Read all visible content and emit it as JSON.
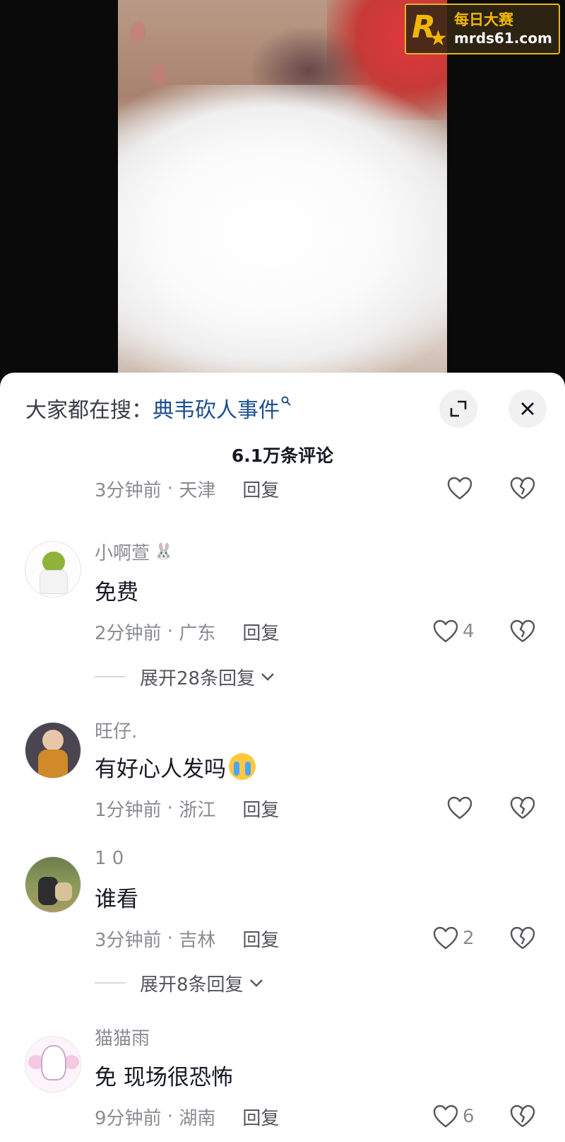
{
  "watermark": {
    "logo_letter": "R",
    "name": "每日大赛",
    "url": "mrds61.com"
  },
  "sheet": {
    "search": {
      "prefix": "大家都在搜：",
      "term": "典韦砍人事件"
    },
    "comment_count": "6.1万条评论",
    "reply_label": "回复",
    "top_meta": {
      "time": "3分钟前",
      "location": "天津"
    },
    "comments": [
      {
        "username": "小啊萱",
        "text": "免费",
        "time": "2分钟前",
        "location": "广东",
        "likes": "4",
        "expand_label": "展开28条回复"
      },
      {
        "username": "旺仔.",
        "text": "有好心人发吗",
        "time": "1分钟前",
        "location": "浙江",
        "likes": ""
      },
      {
        "username": "1 0",
        "text": "谁看",
        "time": "3分钟前",
        "location": "吉林",
        "likes": "2",
        "expand_label": "展开8条回复"
      },
      {
        "username": "猫猫雨",
        "text": "免 现场很恐怖",
        "time": "9分钟前",
        "location": "湖南",
        "likes": "6"
      }
    ]
  },
  "icons": {
    "search": "magnifier-icon",
    "expand": "expand-icon",
    "close": "close-icon",
    "like": "heart-outline-icon",
    "dislike": "broken-heart-icon",
    "chevron": "chevron-down-icon"
  },
  "colors": {
    "search_link": "#1d4f91",
    "watermark_gold": "#f2b705",
    "meta_gray": "#8a8b91"
  }
}
